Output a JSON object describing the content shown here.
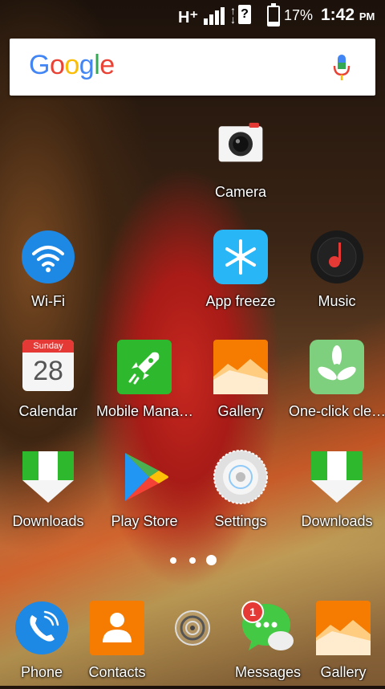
{
  "status_bar": {
    "network": "H⁺",
    "sim_icon": "?",
    "battery_percent": "17%",
    "battery_level": 0.17,
    "time": "1:42",
    "ampm": "PM"
  },
  "search": {
    "logo_letters": [
      "G",
      "o",
      "o",
      "g",
      "l",
      "e"
    ],
    "icon": "mic-icon"
  },
  "apps": {
    "camera": "Camera",
    "wifi": "Wi-Fi",
    "app_freeze": "App freeze",
    "music": "Music",
    "calendar": "Calendar",
    "calendar_day": "Sunday",
    "calendar_date": "28",
    "mobile_manager": "Mobile Mana…",
    "gallery": "Gallery",
    "one_click_clean": "One-click cle…",
    "downloads_1": "Downloads",
    "play_store": "Play Store",
    "settings": "Settings",
    "downloads_2": "Downloads"
  },
  "page_indicator": {
    "pages": 3,
    "current": 3
  },
  "dock": {
    "phone": "Phone",
    "contacts": "Contacts",
    "messages": "Messages",
    "messages_badge": "1",
    "gallery": "Gallery"
  }
}
